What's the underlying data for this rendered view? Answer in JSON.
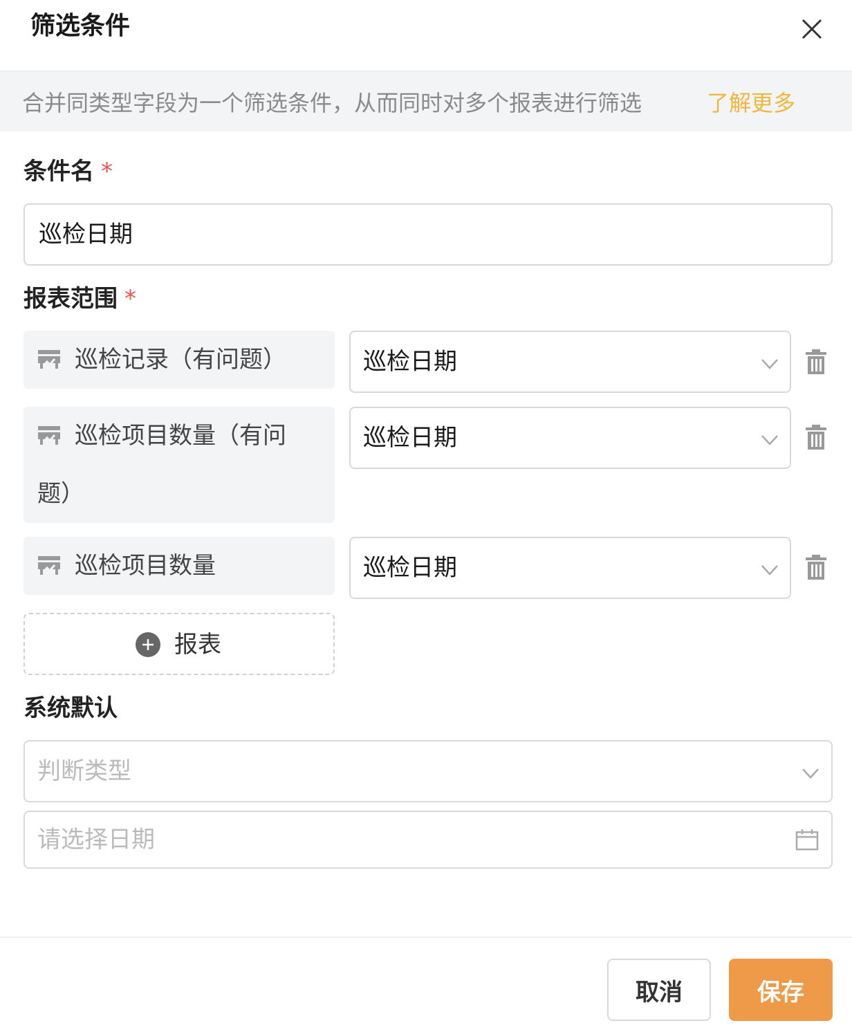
{
  "dialog": {
    "title": "筛选条件"
  },
  "info": {
    "text": "合并同类型字段为一个筛选条件，从而同时对多个报表进行筛选",
    "link": "了解更多"
  },
  "condition_name": {
    "label": "条件名",
    "required_mark": "*",
    "value": "巡检日期"
  },
  "report_scope": {
    "label": "报表范围",
    "required_mark": "*",
    "rows": [
      {
        "report": "巡检记录（有问题）",
        "field": "巡检日期"
      },
      {
        "report": "巡检项目数量（有问题）",
        "field": "巡检日期"
      },
      {
        "report": "巡检项目数量",
        "field": "巡检日期"
      }
    ],
    "add_label": "报表"
  },
  "system_default": {
    "label": "系统默认",
    "judge_type_placeholder": "判断类型",
    "date_placeholder": "请选择日期"
  },
  "footer": {
    "cancel_label": "取消",
    "save_label": "保存"
  },
  "colors": {
    "accent": "#ef9a48",
    "link": "#f0b73c",
    "required": "#e8554e",
    "info_bg": "#f3f4f5"
  },
  "icons": {
    "close": "close-icon",
    "report": "report-icon",
    "chevron": "chevron-down-icon",
    "trash": "trash-icon",
    "add": "plus-circle-icon",
    "calendar": "calendar-icon"
  }
}
